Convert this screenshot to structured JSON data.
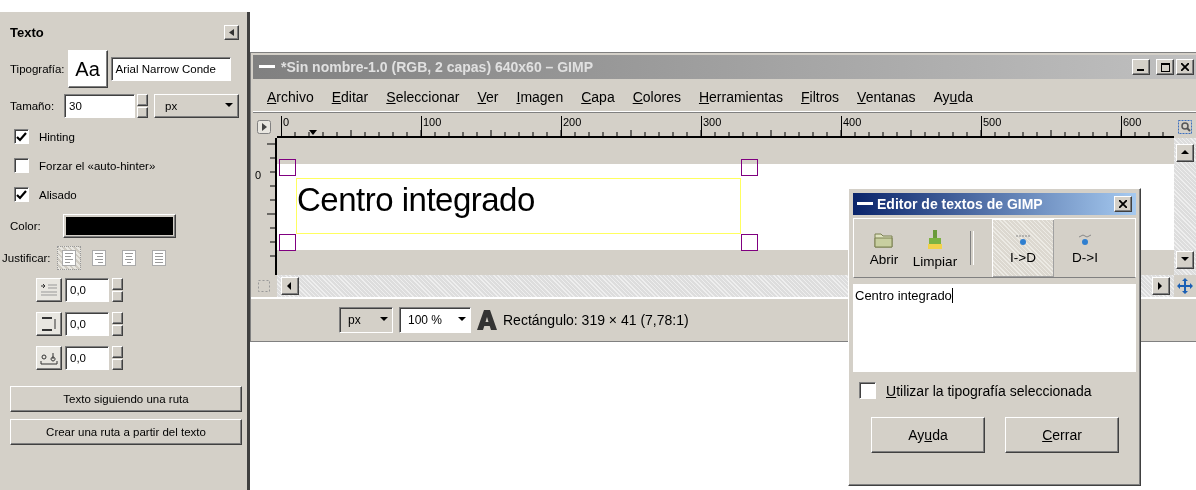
{
  "tool_options": {
    "title": "Texto",
    "font": {
      "label": "Tipografía:",
      "preview": "Aa",
      "value": "Arial Narrow Conde"
    },
    "size": {
      "label": "Tamaño:",
      "value": "30",
      "unit": "px"
    },
    "options": [
      {
        "label": "Hinting",
        "checked": true
      },
      {
        "label": "Forzar el «auto-hinter»",
        "checked": false
      },
      {
        "label": "Alisado",
        "checked": true
      }
    ],
    "color": {
      "label": "Color:"
    },
    "justify": {
      "label": "Justificar:",
      "options": [
        {
          "kind": "left",
          "selected": true
        },
        {
          "kind": "right",
          "selected": false
        },
        {
          "kind": "center",
          "selected": false
        },
        {
          "kind": "fill",
          "selected": false
        }
      ]
    },
    "spacing": [
      {
        "kind": "indent",
        "value": "0,0"
      },
      {
        "kind": "line",
        "value": "0,0"
      },
      {
        "kind": "letter",
        "value": "0,0"
      }
    ],
    "buttons": [
      "Texto siguiendo una ruta",
      "Crear una ruta a partir del texto"
    ]
  },
  "image_window": {
    "title": "*Sin nombre-1.0 (RGB, 2 capas) 640x60 – GIMP",
    "menu": [
      {
        "key": "A",
        "rest": "rchivo"
      },
      {
        "key": "E",
        "rest": "ditar"
      },
      {
        "key": "S",
        "rest": "eleccionar"
      },
      {
        "key": "V",
        "rest": "er"
      },
      {
        "key": "I",
        "rest": "magen"
      },
      {
        "key": "C",
        "rest": "apa"
      },
      {
        "key": "C",
        "rest": "olores"
      },
      {
        "key": "H",
        "rest": "erramientas"
      },
      {
        "key": "F",
        "rest": "iltros"
      },
      {
        "key": "V",
        "rest": "entanas"
      },
      {
        "pre": "Ay",
        "key": "u",
        "rest": "da"
      }
    ],
    "ruler_labels": [
      "0",
      "100",
      "200",
      "300",
      "400",
      "500",
      "600"
    ],
    "vertical_ruler_label": "0",
    "canvas_text": "Centro integrado",
    "status": {
      "unit": "px",
      "zoom": "100 %",
      "message": "Rectángulo: 319 × 41  (7,78:1)"
    }
  },
  "text_editor": {
    "title": "Editor de textos de GIMP",
    "tools": [
      {
        "kind": "open",
        "label": "Abrir",
        "selected": false
      },
      {
        "kind": "clear",
        "label": "Limpiar",
        "selected": false
      },
      {
        "kind": "ltr",
        "label": "I->D",
        "selected": true
      },
      {
        "kind": "rtl",
        "label": "D->I",
        "selected": false
      }
    ],
    "text": "Centro integrado",
    "use_font": {
      "label": {
        "key": "U",
        "rest": "tilizar la tipografía seleccionada"
      },
      "checked": false
    },
    "buttons": [
      {
        "pre": "Ay",
        "key": "u",
        "rest": "da"
      },
      {
        "key": "C",
        "rest": "errar"
      }
    ]
  }
}
